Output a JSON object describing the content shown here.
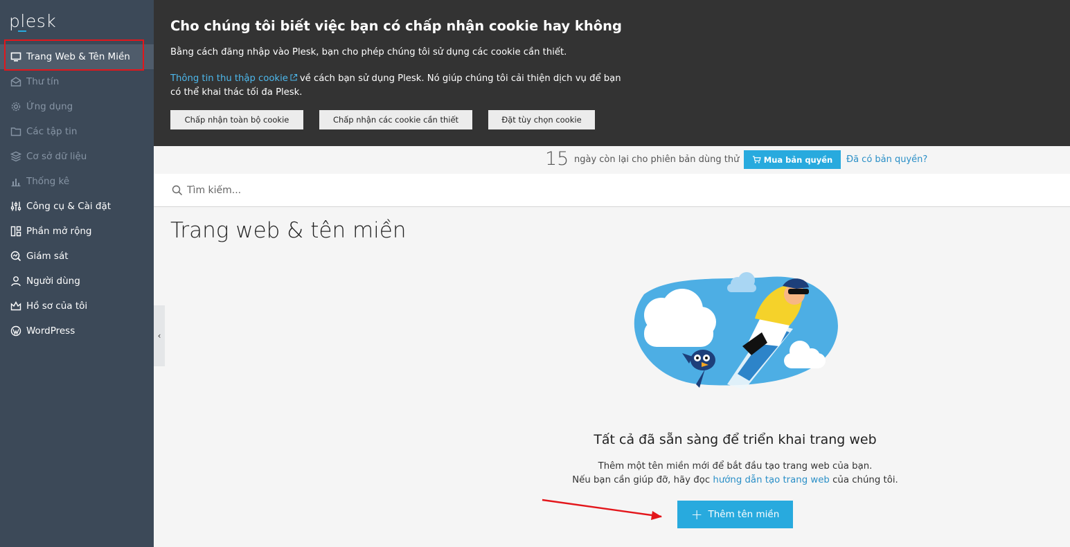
{
  "app": {
    "logo": "plesk"
  },
  "sidebar": {
    "items": [
      {
        "label": "Trang Web & Tên Miền",
        "icon": "monitor-icon",
        "active": true
      },
      {
        "label": "Thư tín",
        "icon": "mail-icon"
      },
      {
        "label": "Ứng dụng",
        "icon": "gear-icon"
      },
      {
        "label": "Các tập tin",
        "icon": "folder-icon"
      },
      {
        "label": "Cơ sở dữ liệu",
        "icon": "database-icon"
      },
      {
        "label": "Thống kê",
        "icon": "bar-chart-icon"
      },
      {
        "label": "Công cụ & Cài đặt",
        "icon": "sliders-icon"
      },
      {
        "label": "Phần mở rộng",
        "icon": "extensions-icon"
      },
      {
        "label": "Giám sát",
        "icon": "monitoring-icon"
      },
      {
        "label": "Người dùng",
        "icon": "user-icon"
      },
      {
        "label": "Hồ sơ của tôi",
        "icon": "crown-icon"
      },
      {
        "label": "WordPress",
        "icon": "wordpress-icon"
      }
    ],
    "collapse_glyph": "‹"
  },
  "cookie_banner": {
    "title": "Cho chúng tôi biết việc bạn có chấp nhận cookie hay không",
    "paragraph1": "Bằng cách đăng nhập vào Plesk, bạn cho phép chúng tôi sử dụng các cookie cần thiết.",
    "link_text": "Thông tin thu thập cookie",
    "paragraph2_rest": "về cách bạn sử dụng Plesk. Nó giúp chúng tôi cải thiện dịch vụ để bạn có thể khai thác tối đa Plesk.",
    "buttons": {
      "accept_all": "Chấp nhận toàn bộ cookie",
      "accept_necessary": "Chấp nhận các cookie cần thiết",
      "customize": "Đặt tùy chọn cookie"
    }
  },
  "trial": {
    "days": "15",
    "text": "ngày còn lại cho phiên bản dùng thử",
    "buy_label": "Mua bản quyền",
    "have_license_label": "Đã có bản quyền?"
  },
  "search": {
    "placeholder": "Tìm kiếm..."
  },
  "main": {
    "title": "Trang web & tên miền",
    "hero_title": "Tất cả đã sẵn sàng để triển khai trang web",
    "hero_line1": "Thêm một tên miền mới để bắt đầu tạo trang web của bạn.",
    "hero_line2_prefix": "Nếu bạn cần giúp đỡ, hãy đọc",
    "hero_line2_link": "hướng dẫn tạo trang web",
    "hero_line2_suffix": "của chúng tôi.",
    "add_domain_label": "Thêm tên miền"
  },
  "colors": {
    "sidebar_bg": "#3c4958",
    "accent": "#28aade",
    "cookie_bg": "#333333",
    "annotation_red": "#e3161b"
  }
}
